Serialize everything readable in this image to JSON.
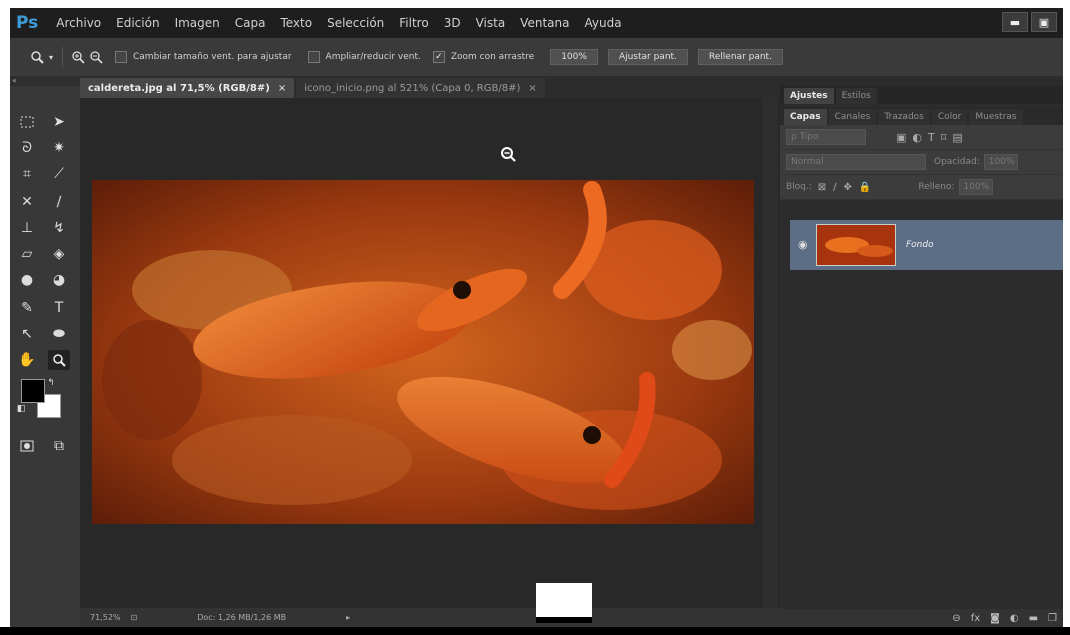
{
  "app": {
    "logo": "Ps"
  },
  "menu": [
    "Archivo",
    "Edición",
    "Imagen",
    "Capa",
    "Texto",
    "Selección",
    "Filtro",
    "3D",
    "Vista",
    "Ventana",
    "Ayuda"
  ],
  "window_buttons": {
    "minimize": "▬",
    "restore": "▣"
  },
  "options": {
    "fit_window_label": "Cambiar tamaño vent. para ajustar",
    "zoom_all_label": "Ampliar/reducir vent.",
    "scrubby_label": "Zoom con arrastre",
    "zoom_value": "100%",
    "fit_screen": "Ajustar pant.",
    "fill_screen": "Rellenar pant."
  },
  "tabs": [
    {
      "label": "caldereta.jpg al 71,5% (RGB/8#)",
      "close": "×"
    },
    {
      "label": "icono_inicio.png al 521% (Capa 0, RGB/8#)",
      "close": "×"
    }
  ],
  "status": {
    "zoom": "71,52%",
    "doc": "Doc: 1,26 MB/1,26 MB",
    "arrow": "▸"
  },
  "panel": {
    "top_tabs": [
      "Ajustes",
      "Estilos"
    ],
    "layer_tabs": [
      "Capas",
      "Canales",
      "Trazados",
      "Color",
      "Muestras"
    ],
    "filter_placeholder": "ρ Tipo",
    "blend_mode": "Normal",
    "opacity_label": "Opacidad:",
    "opacity_value": "100%",
    "lock_label": "Bloq.:",
    "fill_label": "Relleno:",
    "fill_value": "100%",
    "layer_name": "Fondo"
  },
  "colors": {
    "ps_blue": "#3d9bd8",
    "layer_selected": "#5c6d86",
    "panel_bg": "#2c2c2c"
  }
}
